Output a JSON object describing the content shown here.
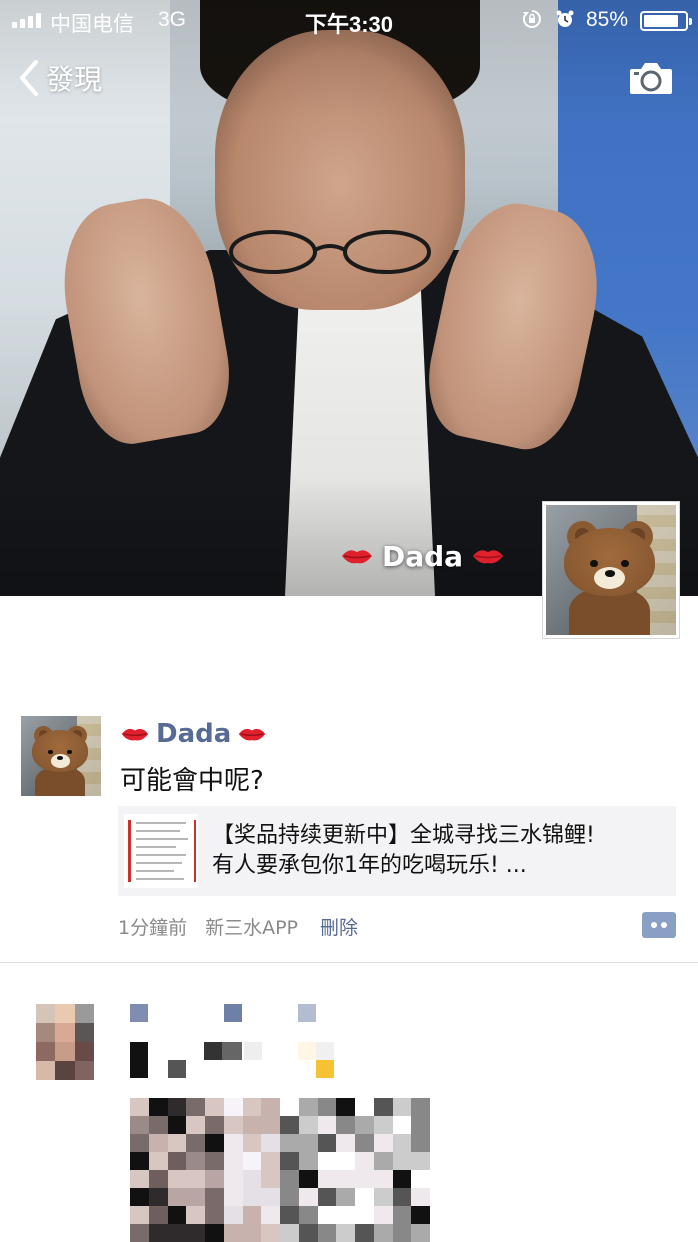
{
  "status_bar": {
    "carrier": "中国电信",
    "network": "3G",
    "time": "下午3:30",
    "battery": "85%",
    "battery_level": 0.85
  },
  "nav": {
    "back_label": "發現",
    "camera_icon": "camera-icon"
  },
  "cover": {
    "user_name": "Dada"
  },
  "post": {
    "author": "Dada",
    "text": "可能會中呢?",
    "link": {
      "title_line1": "【奖品持续更新中】全城寻找三水锦鲤!",
      "title_line2": "有人要承包你1年的吃喝玩乐! ..."
    },
    "time": "1分鐘前",
    "source": "新三水APP",
    "delete_label": "刪除"
  },
  "colors": {
    "name_blue": "#576b95",
    "comment_button": "#8a9fc4",
    "meta_gray": "#8a8a8a",
    "card_bg": "#f3f3f5"
  }
}
